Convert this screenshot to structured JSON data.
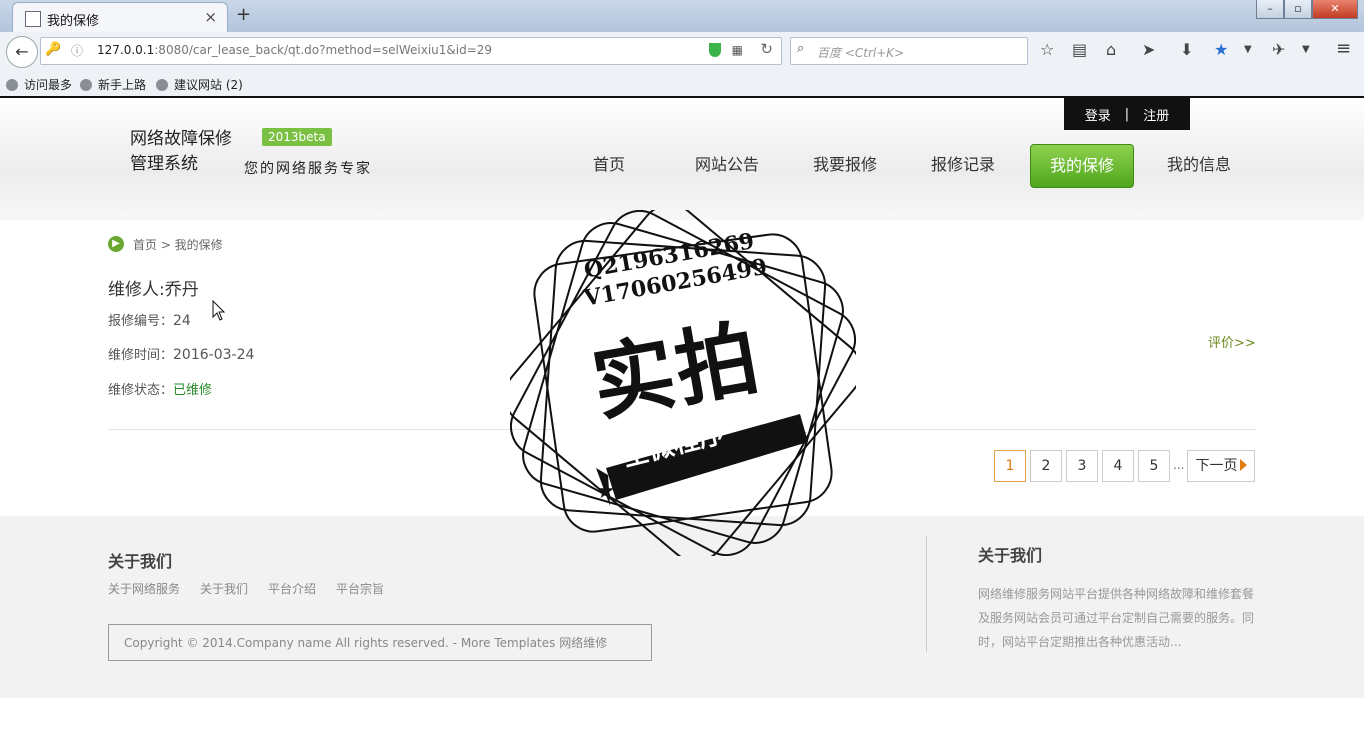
{
  "browser": {
    "tab_title": "我的保修",
    "tab_close": "×",
    "new_tab": "+",
    "url_host": "127.0.0.1",
    "url_rest": ":8080/car_lease_back/qt.do?method=selWeixiu1&id=29",
    "search_placeholder": "百度 <Ctrl+K>",
    "bookmarks": [
      "访问最多",
      "新手上路",
      "建议网站 (2)"
    ]
  },
  "site": {
    "brand_line1": "网络故障保修",
    "brand_line2": "管理系统",
    "beta": "2013beta",
    "slogan": "您的网络服务专家",
    "login": "登录",
    "separator": "|",
    "register": "注册",
    "nav": [
      "首页",
      "网站公告",
      "我要报修",
      "报修记录",
      "我的保修",
      "我的信息"
    ],
    "active_nav": 4
  },
  "breadcrumb": "首页 > 我的保修",
  "record": {
    "worker_label": "维修人:乔丹",
    "repair_no_label": "报修编号：",
    "repair_no": "24",
    "time_label": "维修时间：",
    "time": "2016-03-24",
    "status_label": "维修状态：",
    "status": "已维修",
    "rate": "评价>>"
  },
  "pagination": {
    "pages": [
      "1",
      "2",
      "3",
      "4",
      "5"
    ],
    "current": "1",
    "dots": "...",
    "next": "下一页"
  },
  "footer": {
    "title": "关于我们",
    "links": [
      "关于网络服务",
      "关于我们",
      "平台介绍",
      "平台宗旨"
    ],
    "copyright": "Copyright © 2014.Company name All rights reserved. - More Templates 网络维修",
    "about_title": "关于我们",
    "about_text": "网络维修服务网站平台提供各种网络故障和维修套餐及服务网站会员可通过平台定制自己需要的服务。同时，网站平台定期推出各种优惠活动..."
  },
  "watermark": {
    "line1": "Q2196316269",
    "line2": "V17060256499",
    "big": "实拍",
    "banner": "全微程序"
  }
}
